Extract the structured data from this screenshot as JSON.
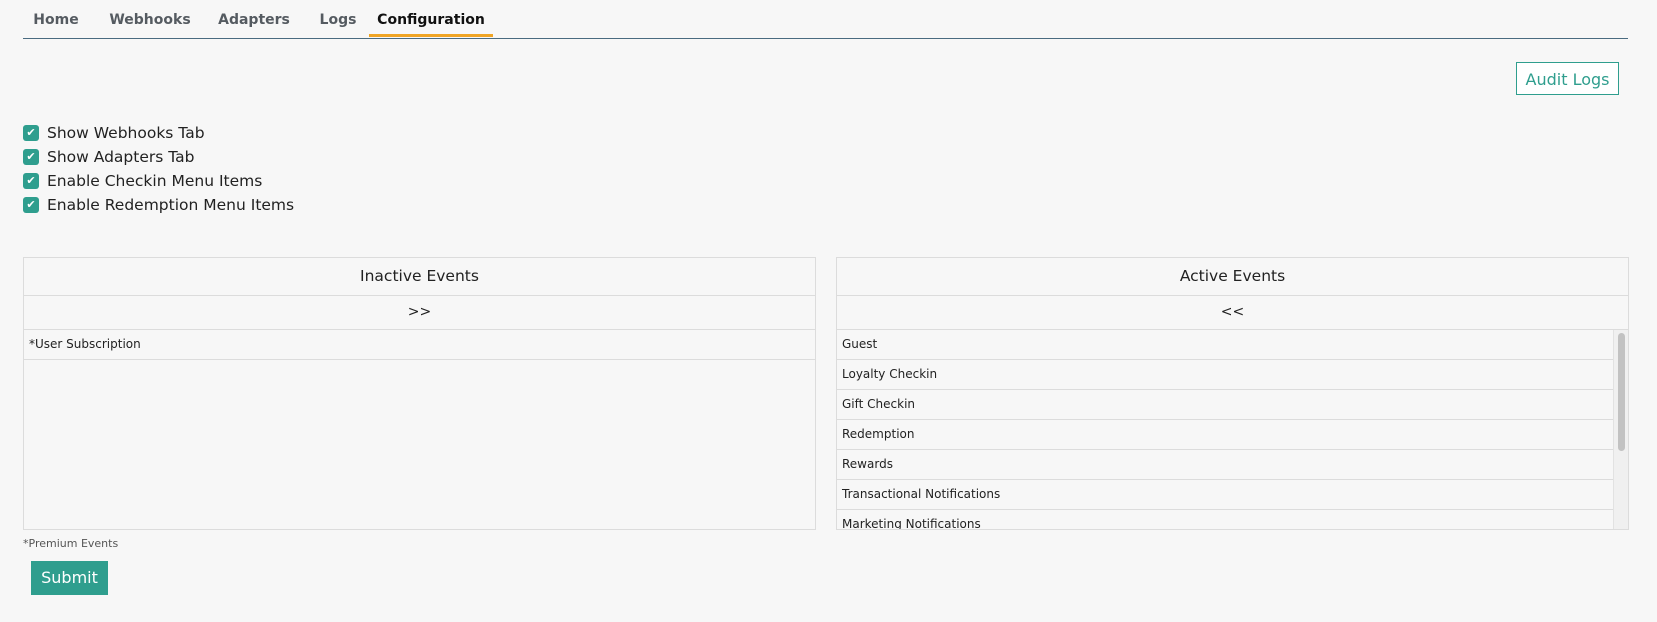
{
  "nav": {
    "tabs": [
      {
        "label": "Home"
      },
      {
        "label": "Webhooks"
      },
      {
        "label": "Adapters"
      },
      {
        "label": "Logs"
      },
      {
        "label": "Configuration"
      }
    ],
    "active_tab": "Configuration"
  },
  "toolbar": {
    "audit_logs_label": "Audit Logs"
  },
  "settings": {
    "checkboxes": [
      {
        "label": "Show Webhooks Tab",
        "checked": true
      },
      {
        "label": "Show Adapters Tab",
        "checked": true
      },
      {
        "label": "Enable Checkin Menu Items",
        "checked": true
      },
      {
        "label": "Enable Redemption Menu Items",
        "checked": true
      }
    ]
  },
  "inactive_events": {
    "title": "Inactive Events",
    "move_label": ">>",
    "items": [
      {
        "label": "*User Subscription"
      }
    ]
  },
  "active_events": {
    "title": "Active Events",
    "move_label": "<<",
    "items": [
      {
        "label": "Guest"
      },
      {
        "label": "Loyalty Checkin"
      },
      {
        "label": "Gift Checkin"
      },
      {
        "label": "Redemption"
      },
      {
        "label": "Rewards"
      },
      {
        "label": "Transactional Notifications"
      },
      {
        "label": "Marketing Notifications"
      }
    ]
  },
  "footer": {
    "premium_note": "*Premium Events",
    "submit_label": "Submit"
  },
  "colors": {
    "accent": "#2f9e8e",
    "active_tab_underline": "#f0a525",
    "background": "#f7f7f7"
  }
}
